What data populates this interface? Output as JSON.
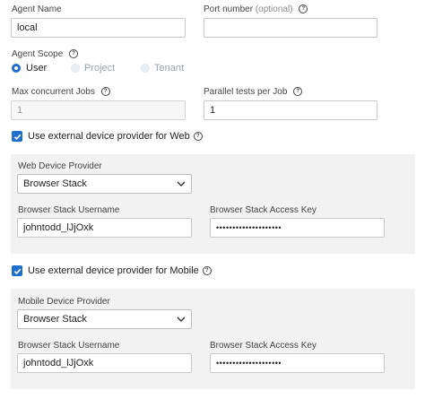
{
  "agent": {
    "name_label": "Agent Name",
    "name_value": "local",
    "port_label": "Port number",
    "port_optional": "(optional)",
    "port_value": "",
    "scope_label": "Agent Scope",
    "scope_options": [
      "User",
      "Project",
      "Tenant"
    ],
    "scope_selected": "User",
    "max_jobs_label": "Max concurrent Jobs",
    "max_jobs_value": "1",
    "parallel_label": "Parallel tests per Job",
    "parallel_value": "1"
  },
  "web": {
    "checkbox_label": "Use external device provider for Web",
    "checked": true,
    "provider_label": "Web Device Provider",
    "provider_value": "Browser Stack",
    "username_label": "Browser Stack Username",
    "username_value": "johntodd_lJjOxk",
    "access_key_label": "Browser Stack Access Key",
    "access_key_value": "••••••••••••••••••••"
  },
  "mobile": {
    "checkbox_label": "Use external device provider for Mobile",
    "checked": true,
    "provider_label": "Mobile Device Provider",
    "provider_value": "Browser Stack",
    "username_label": "Browser Stack Username",
    "username_value": "johntodd_lJjOxk",
    "access_key_label": "Browser Stack Access Key",
    "access_key_value": "••••••••••••••••••••"
  },
  "colors": {
    "accent": "#1f6fcc",
    "panel": "#f2f2f2"
  }
}
